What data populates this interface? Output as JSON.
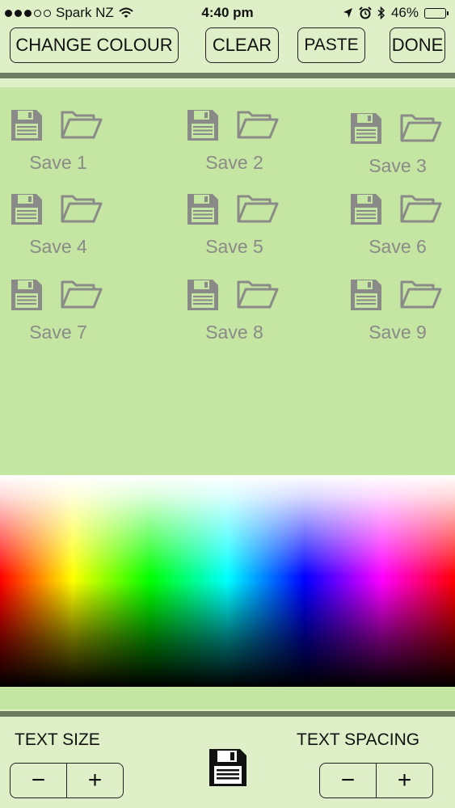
{
  "status_bar": {
    "carrier": "Spark NZ",
    "time": "4:40 pm",
    "battery": "46%",
    "battery_level": 0.46
  },
  "toolbar": {
    "change_colour_label": "CHANGE COLOUR",
    "clear_label": "CLEAR",
    "paste_label": "PASTE",
    "done_label": "DONE"
  },
  "saves": [
    {
      "label": "Save 1"
    },
    {
      "label": "Save 2"
    },
    {
      "label": "Save 3"
    },
    {
      "label": "Save 4"
    },
    {
      "label": "Save 5"
    },
    {
      "label": "Save 6"
    },
    {
      "label": "Save 7"
    },
    {
      "label": "Save 8"
    },
    {
      "label": "Save 9"
    }
  ],
  "bottom": {
    "text_size_label": "TEXT SIZE",
    "text_spacing_label": "TEXT SPACING",
    "minus": "−",
    "plus": "+"
  },
  "colors": {
    "background": "#dff0c8",
    "panel": "#c5e6a2",
    "divider": "#6e7b63",
    "icon_gray": "#8a8a88"
  }
}
